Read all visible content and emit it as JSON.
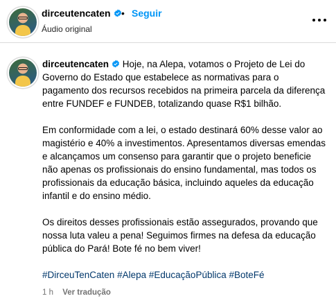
{
  "header": {
    "username": "dirceutencaten",
    "separator": "•",
    "follow_label": "Seguir",
    "audio": "Áudio original"
  },
  "post": {
    "username": "dirceutencaten",
    "paragraphs": [
      "Hoje, na Alepa, votamos o Projeto de Lei do Governo do Estado que estabelece as normativas para o pagamento dos recursos recebidos na primeira parcela da diferença entre FUNDEF e FUNDEB, totalizando quase R$1 bilhão.",
      "Em conformidade com a lei, o estado destinará 60% desse valor ao magistério e 40% a investimentos. Apresentamos diversas emendas e alcançamos um consenso para garantir que o projeto beneficie não apenas os profissionais do ensino fundamental, mas todos os profissionais da educação básica, incluindo aqueles da educação infantil e do ensino médio.",
      "Os direitos desses profissionais estão assegurados, provando que nossa luta valeu a pena! Seguimos firmes na defesa da educação pública do Pará! Bote fé no bem viver!"
    ],
    "hashtags": [
      "#DirceuTenCaten",
      "#Alepa",
      "#EducaçãoPública",
      "#BoteFé"
    ],
    "time": "1 h",
    "translate_label": "Ver tradução"
  },
  "colors": {
    "link": "#0095f6",
    "hashtag": "#00376b",
    "muted": "#737373",
    "verified": "#0095f6"
  }
}
